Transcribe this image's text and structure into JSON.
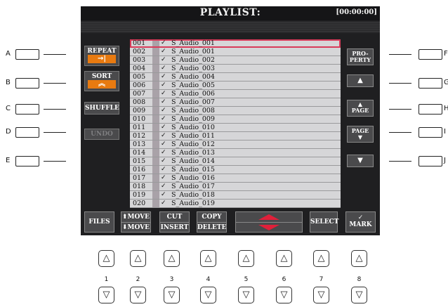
{
  "screen": {
    "title": "PLAYLIST:",
    "time": "[00:00:00]"
  },
  "left_buttons": [
    {
      "label": "REPEAT",
      "icon": "repeat-arrow-icon",
      "glyph": "→|"
    },
    {
      "label": "SORT",
      "icon": "sort-up-icon",
      "glyph": "︽"
    },
    {
      "label": "SHUFFLE"
    },
    {
      "label": "UNDO",
      "disabled": true
    }
  ],
  "right_buttons": [
    {
      "label": "PRO-",
      "label2": "PERTY"
    },
    {
      "icon": "jump-top-icon",
      "glyph": "▲"
    },
    {
      "glyph": "▲",
      "label": "PAGE",
      "icon": "page-up-icon"
    },
    {
      "label": "PAGE",
      "glyph": "▼",
      "icon": "page-down-icon"
    },
    {
      "icon": "jump-bottom-icon",
      "glyph": "▼"
    }
  ],
  "playlist": {
    "selected_index": 0,
    "rows": [
      {
        "num": "001",
        "check": "✓",
        "name": "S_Audio_001"
      },
      {
        "num": "002",
        "check": "✓",
        "name": "S_Audio_001"
      },
      {
        "num": "003",
        "check": "✓",
        "name": "S_Audio_002"
      },
      {
        "num": "004",
        "check": "✓",
        "name": "S_Audio_003"
      },
      {
        "num": "005",
        "check": "✓",
        "name": "S_Audio_004"
      },
      {
        "num": "006",
        "check": "✓",
        "name": "S_Audio_005"
      },
      {
        "num": "007",
        "check": "✓",
        "name": "S_Audio_006"
      },
      {
        "num": "008",
        "check": "✓",
        "name": "S_Audio_007"
      },
      {
        "num": "009",
        "check": "✓",
        "name": "S_Audio_008"
      },
      {
        "num": "010",
        "check": "✓",
        "name": "S_Audio_009"
      },
      {
        "num": "011",
        "check": "✓",
        "name": "S_Audio_010"
      },
      {
        "num": "012",
        "check": "✓",
        "name": "S_Audio_011"
      },
      {
        "num": "013",
        "check": "✓",
        "name": "S_Audio_012"
      },
      {
        "num": "014",
        "check": "✓",
        "name": "S_Audio_013"
      },
      {
        "num": "015",
        "check": "✓",
        "name": "S_Audio_014"
      },
      {
        "num": "016",
        "check": "✓",
        "name": "S_Audio_015"
      },
      {
        "num": "017",
        "check": "✓",
        "name": "S_Audio_016"
      },
      {
        "num": "018",
        "check": "✓",
        "name": "S_Audio_017"
      },
      {
        "num": "019",
        "check": "✓",
        "name": "S_Audio_018"
      },
      {
        "num": "020",
        "check": "✓",
        "name": "S_Audio_019"
      }
    ]
  },
  "bottom_buttons": {
    "files": "FILES",
    "move_up": "⬆MOVE",
    "move_down": "⬇MOVE",
    "cut": "CUT",
    "insert": "INSERT",
    "copy": "COPY",
    "delete": "DELETE",
    "select": "SELECT",
    "mark": "MARK",
    "mark_glyph": "✓"
  },
  "side_labels": {
    "left": [
      "A",
      "B",
      "C",
      "D",
      "E"
    ],
    "right": [
      "F",
      "G",
      "H",
      "I",
      "J"
    ]
  },
  "panel_buttons": {
    "numbers": [
      "1",
      "2",
      "3",
      "4",
      "5",
      "6",
      "7",
      "8"
    ],
    "up_glyph": "△",
    "down_glyph": "▽"
  },
  "colors": {
    "accent_orange": "#e87a10",
    "selection_red": "#d83c5a",
    "arrow_red": "#e0203a",
    "lcd_background": "#1f1f21"
  }
}
